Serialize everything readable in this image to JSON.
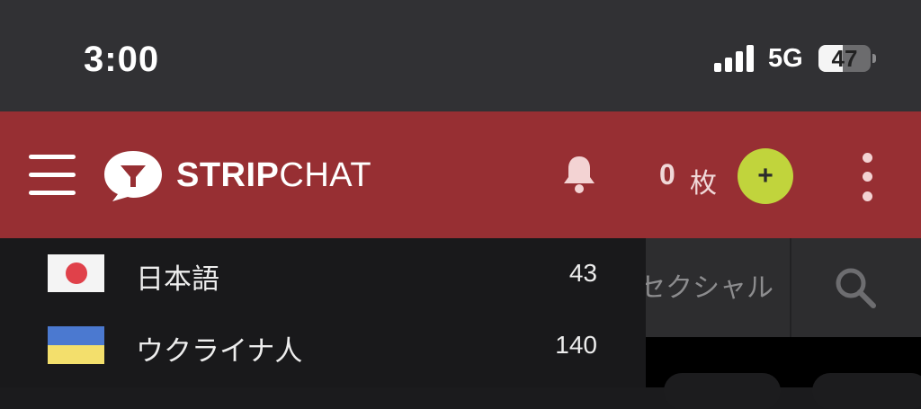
{
  "status_bar": {
    "time": "3:00",
    "network": "5G",
    "battery_level": "47",
    "battery_fraction": 0.47
  },
  "header": {
    "logo_strong": "STRIP",
    "logo_light": "CHAT",
    "tokens_count": "0",
    "tokens_unit": "枚",
    "add_label": "+",
    "brand_color": "#972f33",
    "accent_color": "#c1d43c",
    "icons": [
      "menu-icon",
      "logo-icon",
      "bell-icon",
      "more-icon"
    ]
  },
  "languages": [
    {
      "label": "日本語",
      "count": "43",
      "flag": "japan-flag"
    },
    {
      "label": "ウクライナ人",
      "count": "140",
      "flag": "ukraine-flag"
    }
  ],
  "background": {
    "tag_partial": "セクシャル",
    "search_icon": "search-icon"
  }
}
